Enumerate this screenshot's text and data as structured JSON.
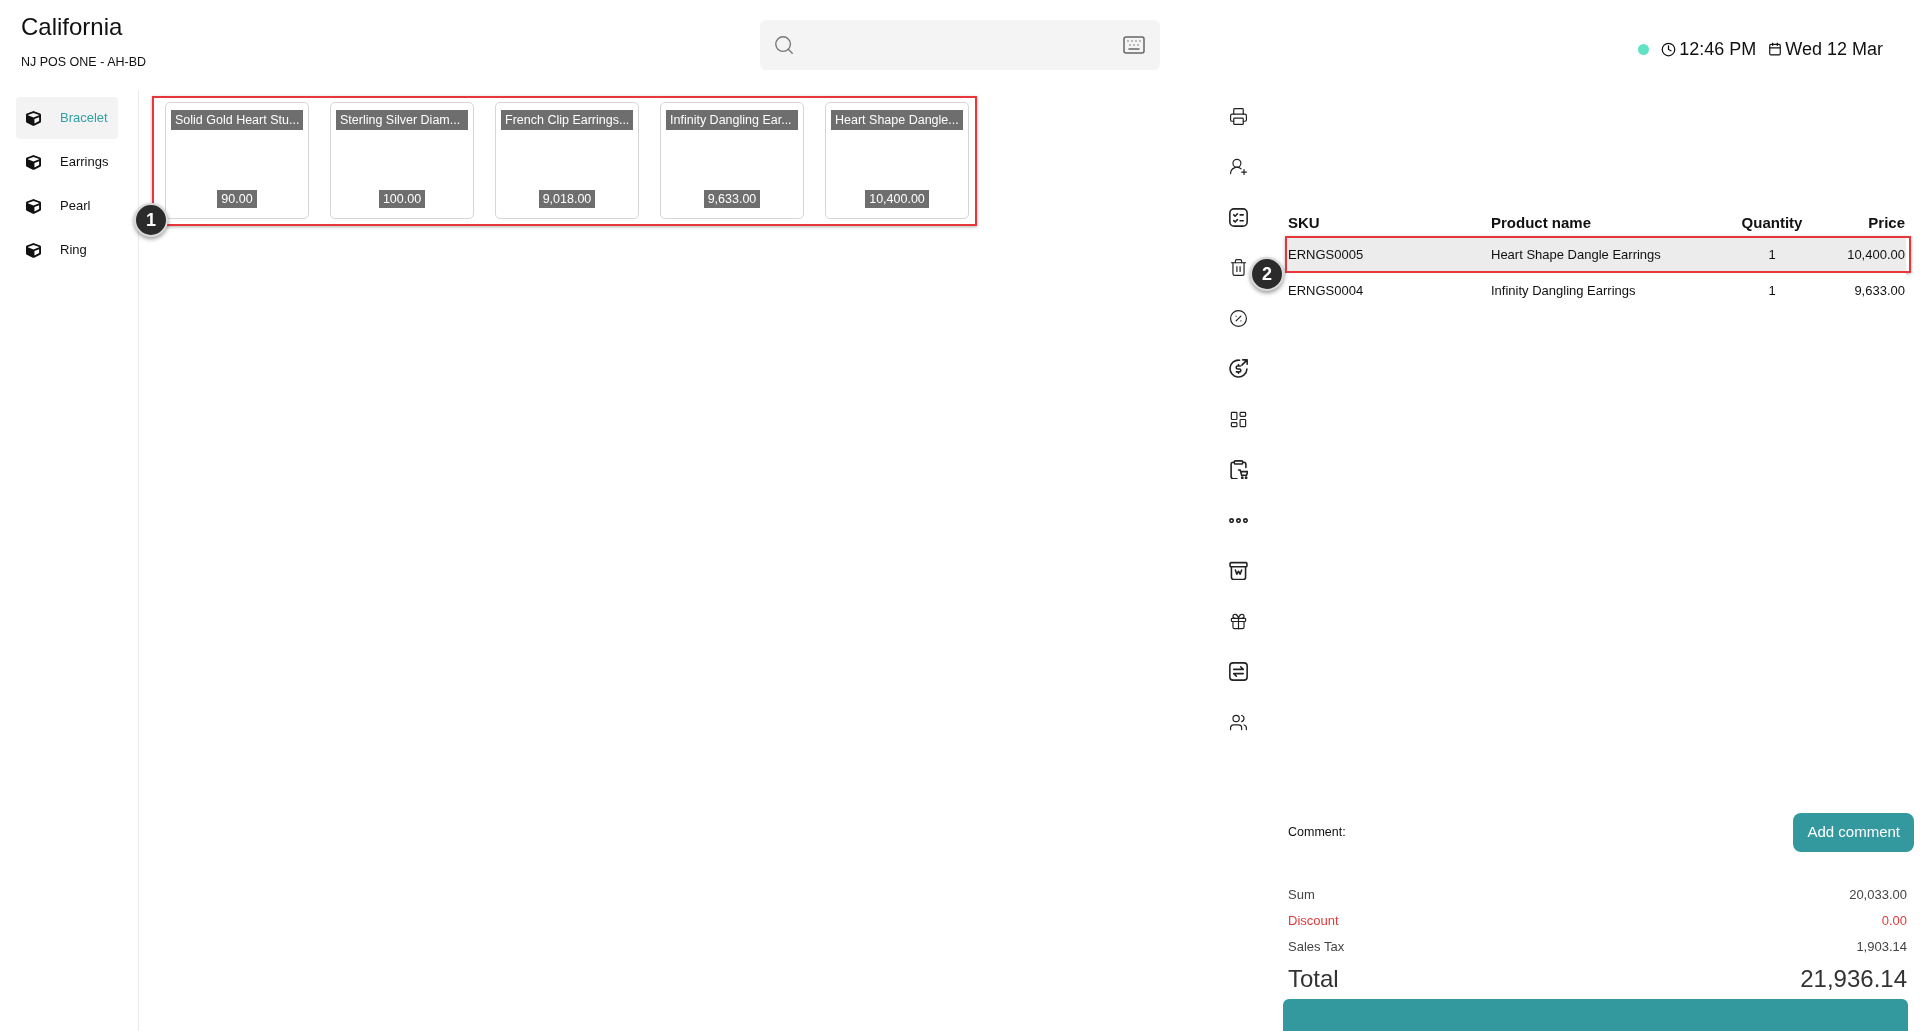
{
  "header": {
    "store_name": "California",
    "terminal": "NJ POS ONE - AH-BD"
  },
  "status": {
    "online": true,
    "time": "12:46 PM",
    "date": "Wed 12 Mar"
  },
  "categories": [
    {
      "label": "Bracelet",
      "selected": true
    },
    {
      "label": "Earrings",
      "selected": false
    },
    {
      "label": "Pearl",
      "selected": false
    },
    {
      "label": "Ring",
      "selected": false
    }
  ],
  "products": {
    "annotation": "1",
    "items": [
      {
        "name": "Solid Gold Heart Stu...",
        "price": "90.00"
      },
      {
        "name": "Sterling Silver Diam...",
        "price": "100.00"
      },
      {
        "name": "French Clip Earrings...",
        "price": "9,018.00"
      },
      {
        "name": "Infinity Dangling Ear...",
        "price": "9,633.00"
      },
      {
        "name": "Heart Shape Dangle...",
        "price": "10,400.00"
      }
    ]
  },
  "cart": {
    "columns": [
      "SKU",
      "Product name",
      "Quantity",
      "Price"
    ],
    "rows": [
      {
        "sku": "ERNGS0005",
        "name": "Heart Shape Dangle Earrings",
        "quantity": "1",
        "price": "10,400.00",
        "selected": true,
        "annotation": "2"
      },
      {
        "sku": "ERNGS0004",
        "name": "Infinity Dangling Earrings",
        "quantity": "1",
        "price": "9,633.00",
        "selected": false
      }
    ]
  },
  "comment": {
    "label": "Comment:",
    "button": "Add comment"
  },
  "summary": [
    {
      "label": "Sum",
      "value": "20,033.00",
      "kind": "normal"
    },
    {
      "label": "Discount",
      "value": "0.00",
      "kind": "discount"
    },
    {
      "label": "Sales Tax",
      "value": "1,903.14",
      "kind": "normal"
    }
  ],
  "total": {
    "label": "Total",
    "value": "21,936.14"
  }
}
